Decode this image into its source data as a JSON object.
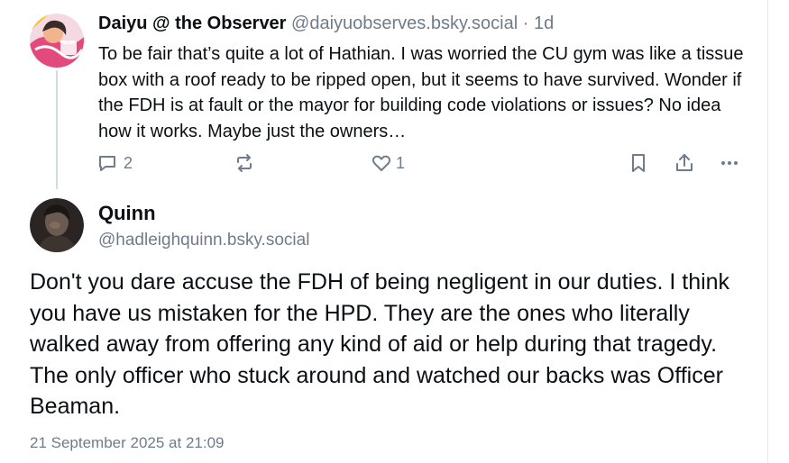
{
  "parent_post": {
    "display_name": "Daiyu @ the Observer",
    "handle": "@daiyuobserves.bsky.social",
    "separator": "·",
    "time": "1d",
    "text": "To be fair that’s quite a lot of Hathian. I was worried the CU gym was like a tissue box with a roof ready to be ripped open, but it seems to have survived. Wonder if the FDH is at fault or the mayor for building code violations or issues? No idea how it works. Maybe just the owners…",
    "actions": {
      "reply_icon": "reply-icon",
      "reply_count": "2",
      "repost_icon": "repost-icon",
      "like_icon": "heart-icon",
      "like_count": "1",
      "bookmark_icon": "bookmark-icon",
      "share_icon": "share-icon",
      "more_icon": "more-icon"
    }
  },
  "main_post": {
    "display_name": "Quinn",
    "handle": "@hadleighquinn.bsky.social",
    "text": "Don't you dare accuse the FDH of being negligent in our duties. I think you have us mistaken for the HPD. They are the ones who literally walked away from offering any kind of aid or help during that tragedy. The only officer who stuck around and watched our backs was Officer Beaman.",
    "timestamp": "21 September 2025 at 21:09"
  },
  "colors": {
    "text": "#0b0f14",
    "muted": "#6f7c8a",
    "thread_line": "#d4dbe2",
    "border": "#e6eaee"
  }
}
